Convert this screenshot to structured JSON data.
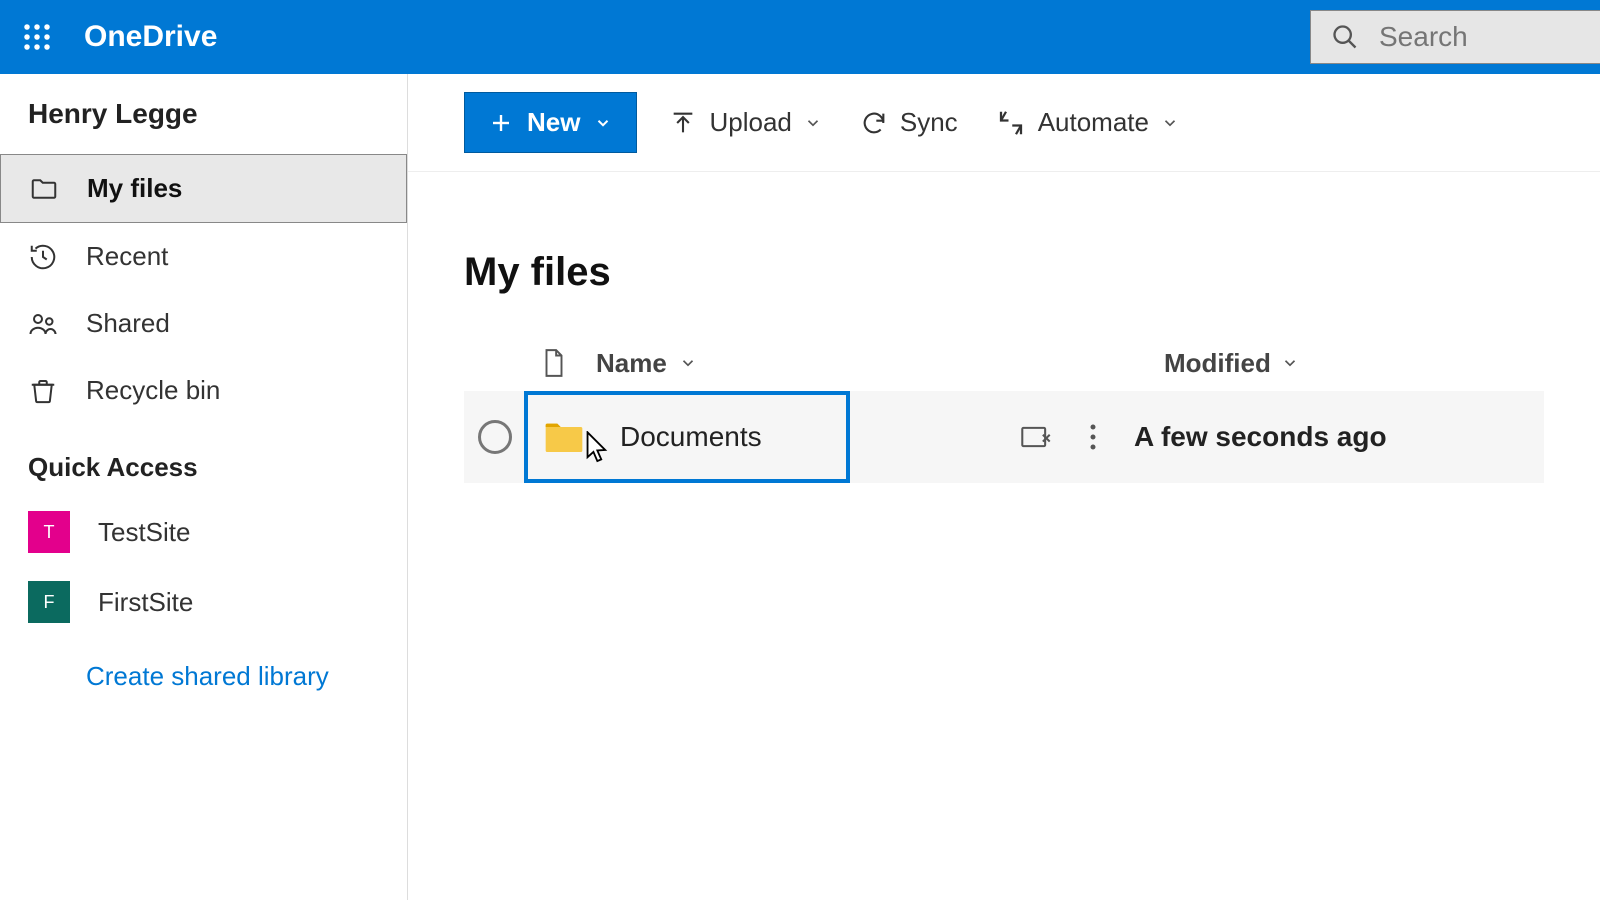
{
  "app": {
    "name": "OneDrive"
  },
  "search": {
    "placeholder": "Search"
  },
  "sidebar": {
    "user_name": "Henry Legge",
    "nav": {
      "my_files": "My files",
      "recent": "Recent",
      "shared": "Shared",
      "recycle_bin": "Recycle bin"
    },
    "quick_access": {
      "heading": "Quick Access",
      "items": [
        {
          "label": "TestSite",
          "initial": "T",
          "color": "#e3008c"
        },
        {
          "label": "FirstSite",
          "initial": "F",
          "color": "#0b6a5f"
        }
      ],
      "create_link": "Create shared library"
    }
  },
  "commands": {
    "new": "New",
    "upload": "Upload",
    "sync": "Sync",
    "automate": "Automate"
  },
  "page": {
    "title": "My files"
  },
  "table": {
    "columns": {
      "name": "Name",
      "modified": "Modified"
    },
    "rows": [
      {
        "name": "Documents",
        "modified": "A few seconds ago"
      }
    ]
  }
}
